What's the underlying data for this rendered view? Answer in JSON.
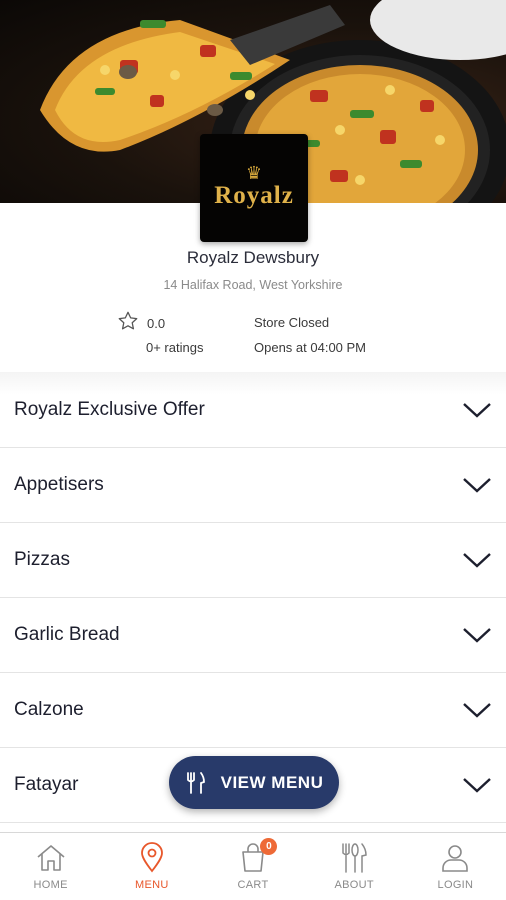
{
  "store": {
    "logo_text": "Royalz",
    "name": "Royalz Dewsbury",
    "address": "14 Halifax Road, West Yorkshire",
    "rating_value": "0.0",
    "rating_count": "0+ ratings",
    "status": "Store Closed",
    "opens_at": "Opens at 04:00 PM"
  },
  "categories": [
    {
      "label": "Royalz Exclusive Offer"
    },
    {
      "label": "Appetisers"
    },
    {
      "label": "Pizzas"
    },
    {
      "label": "Garlic Bread"
    },
    {
      "label": "Calzone"
    },
    {
      "label": "Fatayar"
    }
  ],
  "view_menu_button": {
    "label": "VIEW MENU",
    "icon": "cutlery-icon"
  },
  "bottom_nav": {
    "items": [
      {
        "label": "HOME",
        "icon": "home-icon"
      },
      {
        "label": "MENU",
        "icon": "location-pin-icon",
        "active": true
      },
      {
        "label": "CART",
        "icon": "shopping-bag-icon",
        "badge": "0"
      },
      {
        "label": "ABOUT",
        "icon": "cutlery-icon"
      },
      {
        "label": "LOGIN",
        "icon": "user-icon"
      }
    ]
  },
  "colors": {
    "accent": "#e8572b",
    "button_bg": "#283a6a",
    "badge": "#ee6a37",
    "text_dark": "#1d1f2e",
    "text_muted": "#8a8a8a"
  }
}
